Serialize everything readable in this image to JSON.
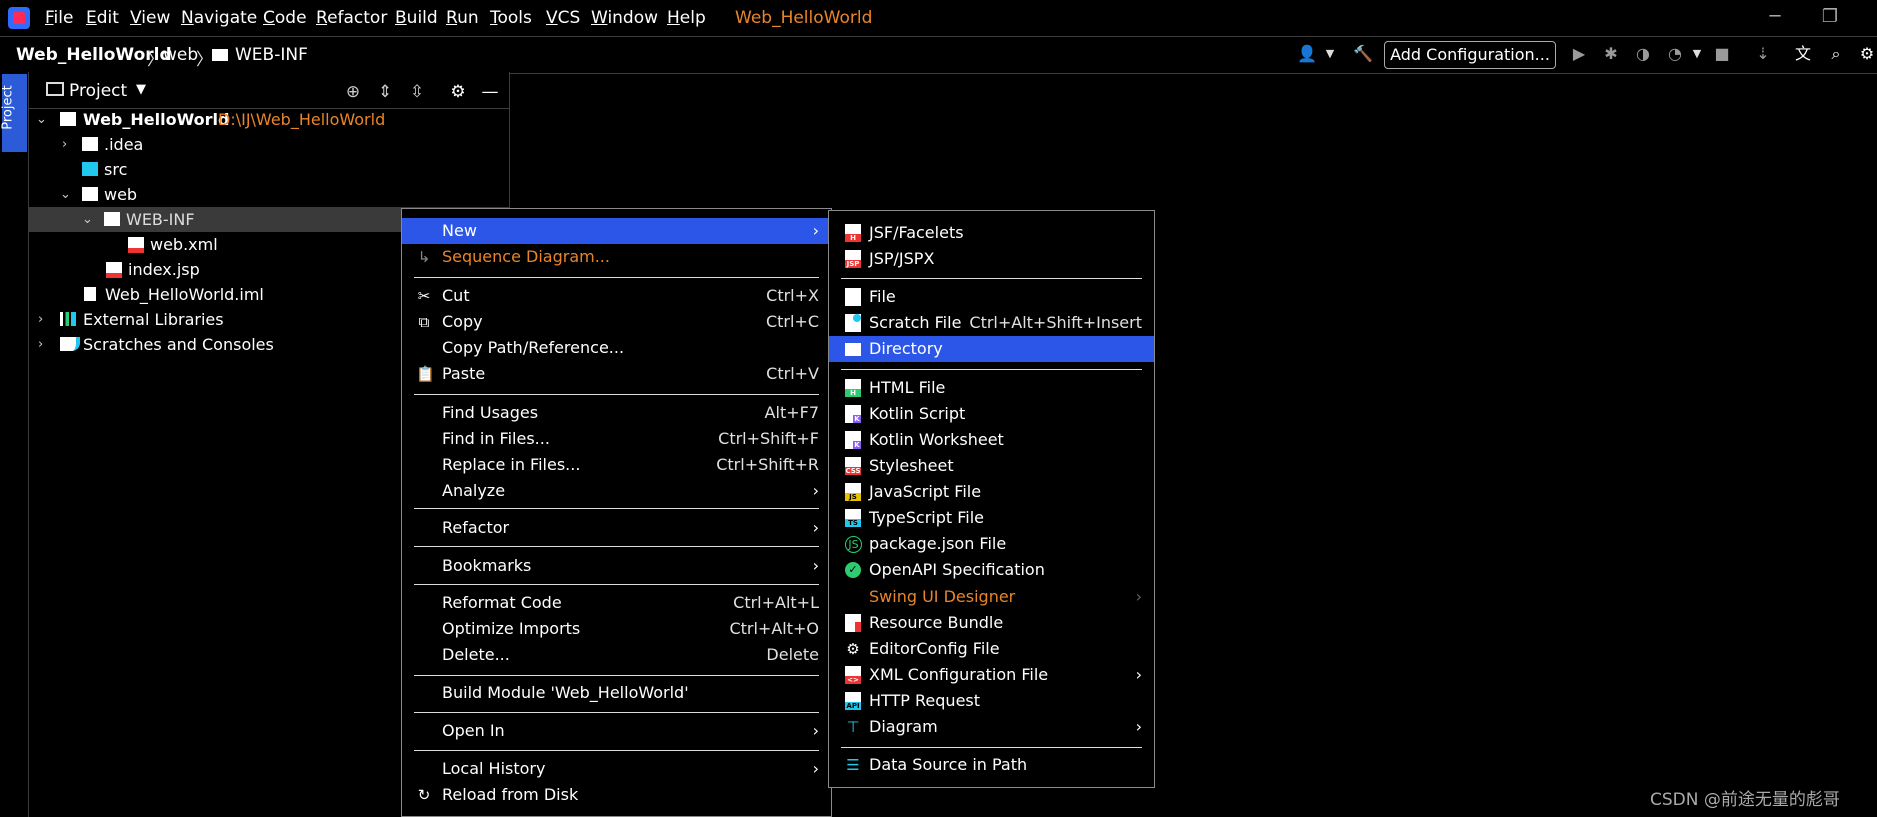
{
  "menubar": {
    "items": [
      "File",
      "Edit",
      "View",
      "Navigate",
      "Code",
      "Refactor",
      "Build",
      "Run",
      "Tools",
      "VCS",
      "Window",
      "Help"
    ],
    "window_title": "Web_HelloWorld"
  },
  "navbar": {
    "root": "Web_HelloWorld",
    "web": "web",
    "webinf": "WEB-INF",
    "add_configuration": "Add Configuration..."
  },
  "stripe": {
    "project_label": "Project"
  },
  "panel": {
    "title": "Project",
    "tree": [
      {
        "label": "Web_HelloWorld",
        "path": "D:\\IJ\\Web_HelloWorld"
      },
      {
        "label": ".idea"
      },
      {
        "label": "src"
      },
      {
        "label": "web"
      },
      {
        "label": "WEB-INF"
      },
      {
        "label": "web.xml"
      },
      {
        "label": "index.jsp"
      },
      {
        "label": "Web_HelloWorld.iml"
      },
      {
        "label": "External Libraries"
      },
      {
        "label": "Scratches and Consoles"
      }
    ]
  },
  "context_menu": {
    "items": [
      {
        "label": "New"
      },
      {
        "label": "Sequence Diagram..."
      },
      {
        "label": "Cut",
        "shortcut": "Ctrl+X"
      },
      {
        "label": "Copy",
        "shortcut": "Ctrl+C"
      },
      {
        "label": "Copy Path/Reference..."
      },
      {
        "label": "Paste",
        "shortcut": "Ctrl+V"
      },
      {
        "label": "Find Usages",
        "shortcut": "Alt+F7"
      },
      {
        "label": "Find in Files...",
        "shortcut": "Ctrl+Shift+F"
      },
      {
        "label": "Replace in Files...",
        "shortcut": "Ctrl+Shift+R"
      },
      {
        "label": "Analyze"
      },
      {
        "label": "Refactor"
      },
      {
        "label": "Bookmarks"
      },
      {
        "label": "Reformat Code",
        "shortcut": "Ctrl+Alt+L"
      },
      {
        "label": "Optimize Imports",
        "shortcut": "Ctrl+Alt+O"
      },
      {
        "label": "Delete...",
        "shortcut": "Delete"
      },
      {
        "label": "Build Module 'Web_HelloWorld'"
      },
      {
        "label": "Open In"
      },
      {
        "label": "Local History"
      },
      {
        "label": "Reload from Disk"
      }
    ]
  },
  "submenu": {
    "items": [
      {
        "label": "JSF/Facelets"
      },
      {
        "label": "JSP/JSPX"
      },
      {
        "label": "File"
      },
      {
        "label": "Scratch File",
        "shortcut": "Ctrl+Alt+Shift+Insert"
      },
      {
        "label": "Directory"
      },
      {
        "label": "HTML File"
      },
      {
        "label": "Kotlin Script"
      },
      {
        "label": "Kotlin Worksheet"
      },
      {
        "label": "Stylesheet"
      },
      {
        "label": "JavaScript File"
      },
      {
        "label": "TypeScript File"
      },
      {
        "label": "package.json File"
      },
      {
        "label": "OpenAPI Specification"
      },
      {
        "label": "Swing UI Designer"
      },
      {
        "label": "Resource Bundle"
      },
      {
        "label": "EditorConfig File"
      },
      {
        "label": "XML Configuration File"
      },
      {
        "label": "HTTP Request"
      },
      {
        "label": "Diagram"
      },
      {
        "label": "Data Source in Path"
      }
    ]
  },
  "watermark": "CSDN @前途无量的彪哥",
  "colors": {
    "highlight": "#2b56e8",
    "accent_orange": "#e8852a",
    "selection_gray": "#3a3a3a"
  }
}
